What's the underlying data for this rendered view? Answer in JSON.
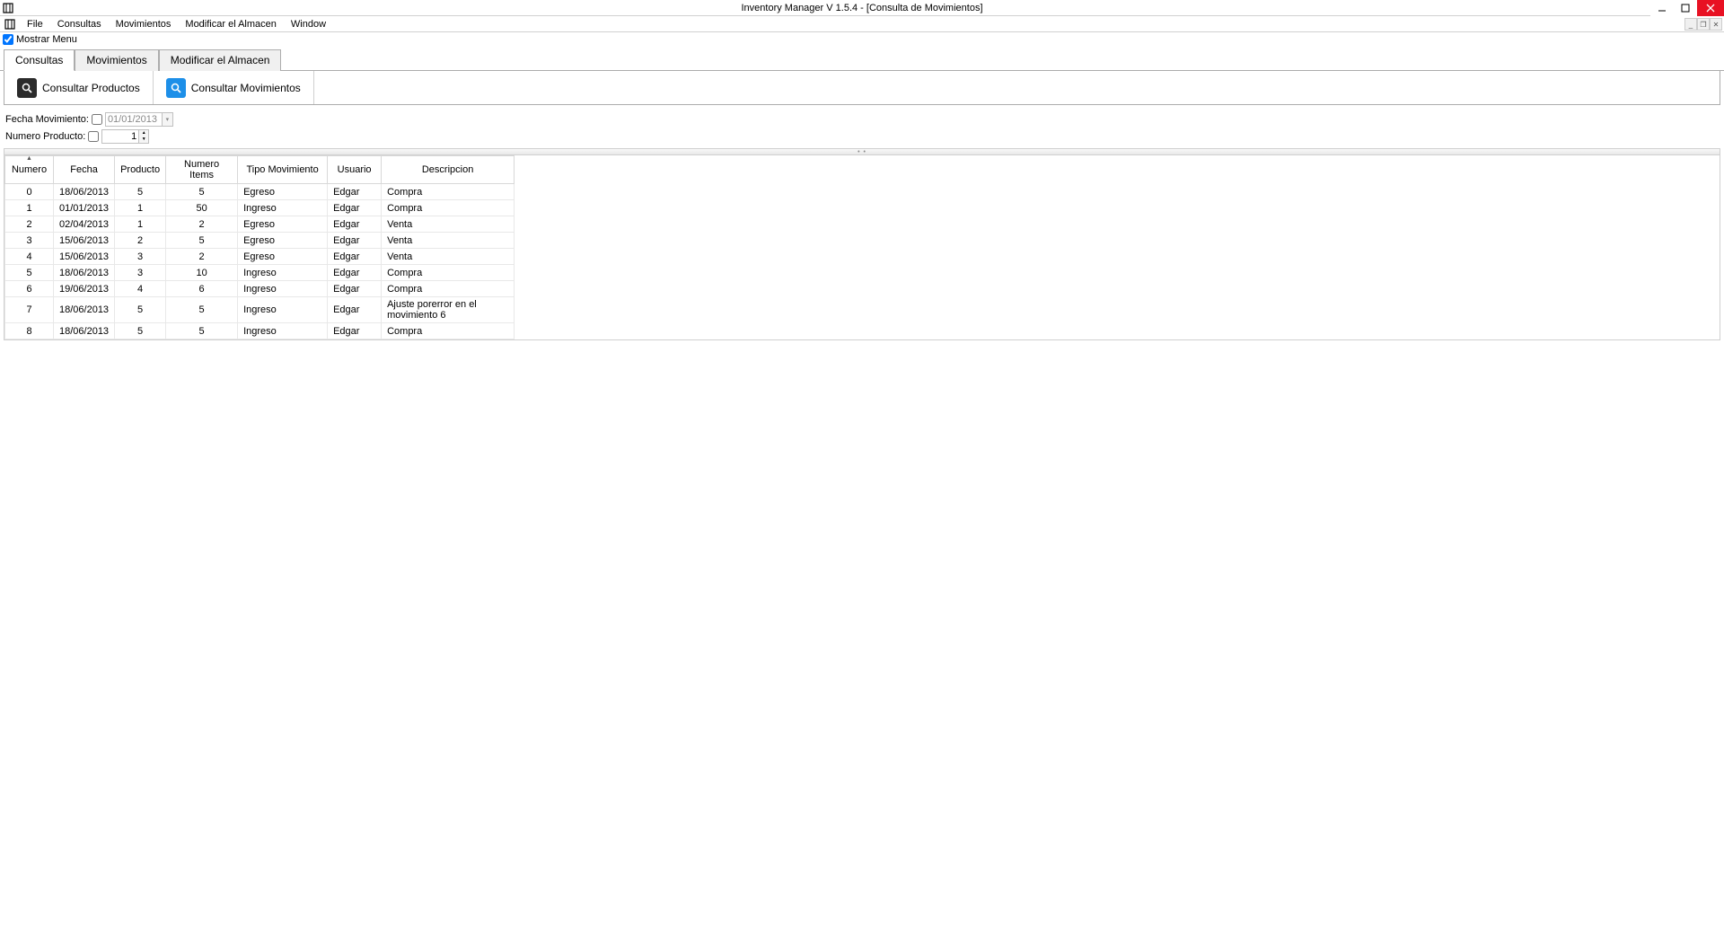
{
  "window": {
    "title": "Inventory Manager V 1.5.4 - [Consulta de Movimientos]"
  },
  "menu": {
    "items": [
      "File",
      "Consultas",
      "Movimientos",
      "Modificar el Almacen",
      "Window"
    ]
  },
  "show_menu": {
    "label": "Mostrar Menu",
    "checked": true
  },
  "tabs": {
    "items": [
      "Consultas",
      "Movimientos",
      "Modificar el Almacen"
    ],
    "active_index": 0
  },
  "toolbar": {
    "consultar_productos": "Consultar Productos",
    "consultar_movimientos": "Consultar Movimientos"
  },
  "filters": {
    "fecha_label": "Fecha Movimiento:",
    "fecha_value": "01/01/2013",
    "fecha_checked": false,
    "numero_label": "Numero Producto:",
    "numero_value": "1",
    "numero_checked": false
  },
  "grid": {
    "columns": [
      "Numero",
      "Fecha",
      "Producto",
      "Numero Items",
      "Tipo Movimiento",
      "Usuario",
      "Descripcion"
    ],
    "sort_column": 0,
    "rows": [
      {
        "numero": "0",
        "fecha": "18/06/2013",
        "producto": "5",
        "items": "5",
        "tipo": "Egreso",
        "usuario": "Edgar",
        "desc": "Compra"
      },
      {
        "numero": "1",
        "fecha": "01/01/2013",
        "producto": "1",
        "items": "50",
        "tipo": "Ingreso",
        "usuario": "Edgar",
        "desc": "Compra"
      },
      {
        "numero": "2",
        "fecha": "02/04/2013",
        "producto": "1",
        "items": "2",
        "tipo": "Egreso",
        "usuario": "Edgar",
        "desc": "Venta"
      },
      {
        "numero": "3",
        "fecha": "15/06/2013",
        "producto": "2",
        "items": "5",
        "tipo": "Egreso",
        "usuario": "Edgar",
        "desc": "Venta"
      },
      {
        "numero": "4",
        "fecha": "15/06/2013",
        "producto": "3",
        "items": "2",
        "tipo": "Egreso",
        "usuario": "Edgar",
        "desc": "Venta"
      },
      {
        "numero": "5",
        "fecha": "18/06/2013",
        "producto": "3",
        "items": "10",
        "tipo": "Ingreso",
        "usuario": "Edgar",
        "desc": "Compra"
      },
      {
        "numero": "6",
        "fecha": "19/06/2013",
        "producto": "4",
        "items": "6",
        "tipo": "Ingreso",
        "usuario": "Edgar",
        "desc": "Compra"
      },
      {
        "numero": "7",
        "fecha": "18/06/2013",
        "producto": "5",
        "items": "5",
        "tipo": "Ingreso",
        "usuario": "Edgar",
        "desc": "Ajuste porerror en el movimiento 6"
      },
      {
        "numero": "8",
        "fecha": "18/06/2013",
        "producto": "5",
        "items": "5",
        "tipo": "Ingreso",
        "usuario": "Edgar",
        "desc": "Compra"
      }
    ]
  }
}
